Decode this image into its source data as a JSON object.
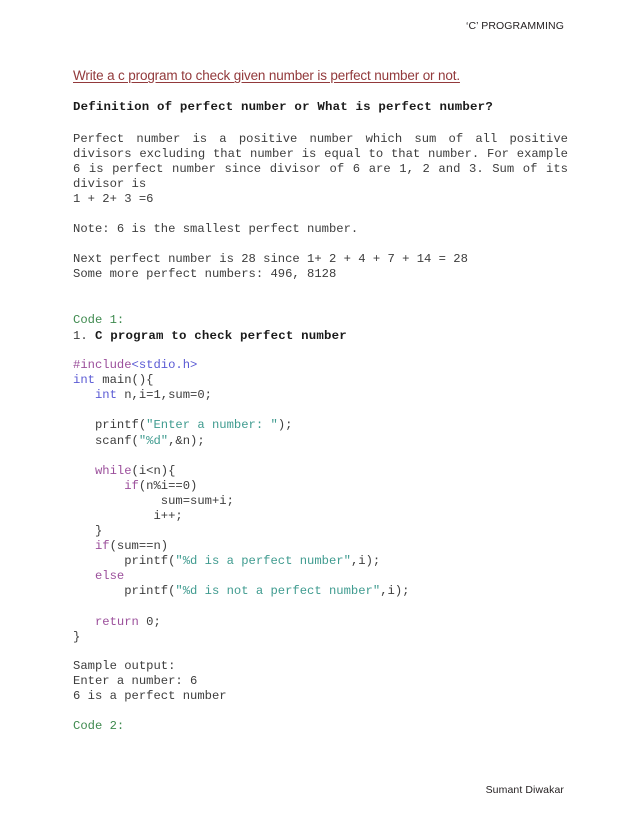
{
  "header": {
    "running_head": "‘C’ PROGRAMMING"
  },
  "footer": {
    "author": "Sumant Diwakar"
  },
  "document": {
    "title": "Write a c program to check given number is perfect number or not.",
    "subheading": "Definition of perfect number or What is perfect number?",
    "definition_paragraph": "Perfect number is a positive number which sum of all positive divisors excluding that number is equal to that number. For example 6 is perfect number since divisor of 6 are 1, 2 and 3.  Sum of its divisor is",
    "definition_sum_line": "1 + 2+ 3 =6",
    "note_line": "Note: 6 is the smallest perfect number.",
    "next_perfect_line": "Next perfect number is 28 since 1+ 2 + 4 + 7 + 14 = 28",
    "more_perfect_line": "Some more perfect numbers: 496, 8128",
    "code1_label": "Code 1:",
    "code1_number": "1. ",
    "code1_heading": "C program to check perfect number",
    "sample_output_label": "Sample output:",
    "sample_output_line1": "Enter a number: 6",
    "sample_output_line2": "6 is a perfect number",
    "code2_label": "Code 2:"
  },
  "code1": {
    "lines": [
      [
        {
          "t": "#include",
          "c": "keyword"
        },
        {
          "t": "<stdio.h>",
          "c": "header"
        }
      ],
      [
        {
          "t": "int",
          "c": "type"
        },
        {
          "t": " main(){",
          "c": "plain"
        }
      ],
      [
        {
          "t": "   ",
          "c": "plain"
        },
        {
          "t": "int",
          "c": "type"
        },
        {
          "t": " n,i=1,sum=0;",
          "c": "plain"
        }
      ],
      [],
      [
        {
          "t": "   printf(",
          "c": "plain"
        },
        {
          "t": "\"Enter a number: \"",
          "c": "string"
        },
        {
          "t": ");",
          "c": "plain"
        }
      ],
      [
        {
          "t": "   scanf(",
          "c": "plain"
        },
        {
          "t": "\"%d\"",
          "c": "string"
        },
        {
          "t": ",&n);",
          "c": "plain"
        }
      ],
      [],
      [
        {
          "t": "   ",
          "c": "plain"
        },
        {
          "t": "while",
          "c": "keyword"
        },
        {
          "t": "(i<n){",
          "c": "plain"
        }
      ],
      [
        {
          "t": "       ",
          "c": "plain"
        },
        {
          "t": "if",
          "c": "keyword"
        },
        {
          "t": "(n%i==0)",
          "c": "plain"
        }
      ],
      [
        {
          "t": "            sum=sum+i;",
          "c": "plain"
        }
      ],
      [
        {
          "t": "           i++;",
          "c": "plain"
        }
      ],
      [
        {
          "t": "   }",
          "c": "plain"
        }
      ],
      [
        {
          "t": "   ",
          "c": "plain"
        },
        {
          "t": "if",
          "c": "keyword"
        },
        {
          "t": "(sum==n)",
          "c": "plain"
        }
      ],
      [
        {
          "t": "       printf(",
          "c": "plain"
        },
        {
          "t": "\"%d is a perfect number\"",
          "c": "string"
        },
        {
          "t": ",i);",
          "c": "plain"
        }
      ],
      [
        {
          "t": "   ",
          "c": "plain"
        },
        {
          "t": "else",
          "c": "keyword"
        }
      ],
      [
        {
          "t": "       printf(",
          "c": "plain"
        },
        {
          "t": "\"%d is not a perfect number\"",
          "c": "string"
        },
        {
          "t": ",i);",
          "c": "plain"
        }
      ],
      [],
      [
        {
          "t": "   ",
          "c": "plain"
        },
        {
          "t": "return",
          "c": "keyword"
        },
        {
          "t": " 0;",
          "c": "plain"
        }
      ],
      [
        {
          "t": "}",
          "c": "plain"
        }
      ]
    ]
  },
  "colors": {
    "title": "#92393b",
    "keyword": "#9b4f9b",
    "type": "#5a5ad4",
    "string": "#3f9b8f",
    "green_label": "#3f8a4f",
    "body": "#3d3d3d"
  }
}
